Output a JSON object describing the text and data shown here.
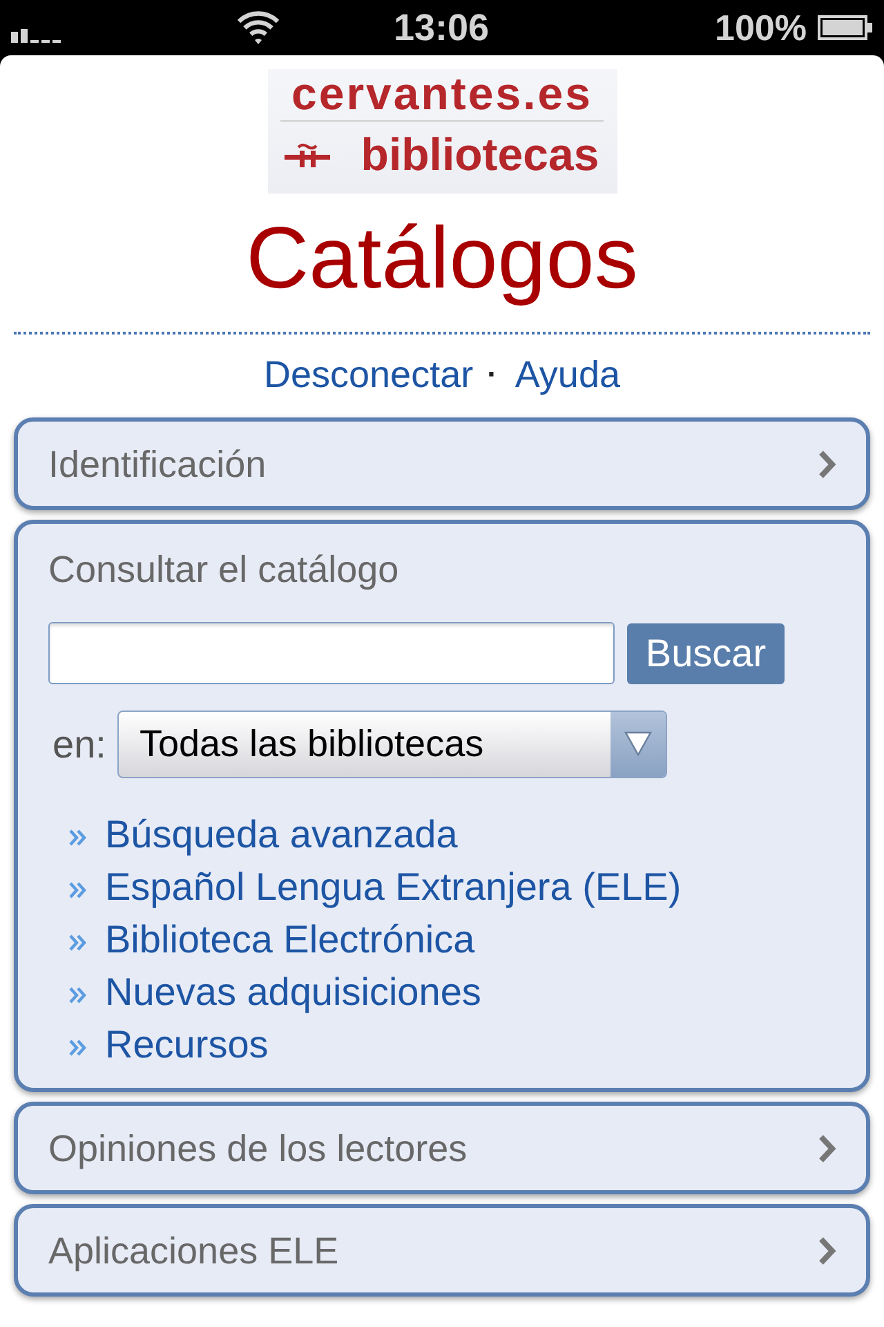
{
  "status_bar": {
    "time": "13:06",
    "battery": "100%"
  },
  "logo": {
    "name": "cervantes.es",
    "subtitle": "bibliotecas"
  },
  "title": "Catálogos",
  "top_links": {
    "items": [
      {
        "label": "Desconectar"
      },
      {
        "label": "Ayuda"
      }
    ],
    "separator": "·"
  },
  "sections": [
    {
      "title": "Identificación",
      "expanded": false
    },
    {
      "title": "Consultar el catálogo",
      "expanded": true,
      "search": {
        "button": "Buscar",
        "scope_label": "en:",
        "scope": "Todas las bibliotecas"
      },
      "links": [
        {
          "label": "Búsqueda avanzada"
        },
        {
          "label": "Español Lengua Extranjera (ELE)"
        },
        {
          "label": "Biblioteca Electrónica"
        },
        {
          "label": "Nuevas adquisiciones"
        },
        {
          "label": "Recursos"
        }
      ]
    },
    {
      "title": "Opiniones de los lectores",
      "expanded": false
    },
    {
      "title": "Aplicaciones ELE",
      "expanded": false
    }
  ]
}
